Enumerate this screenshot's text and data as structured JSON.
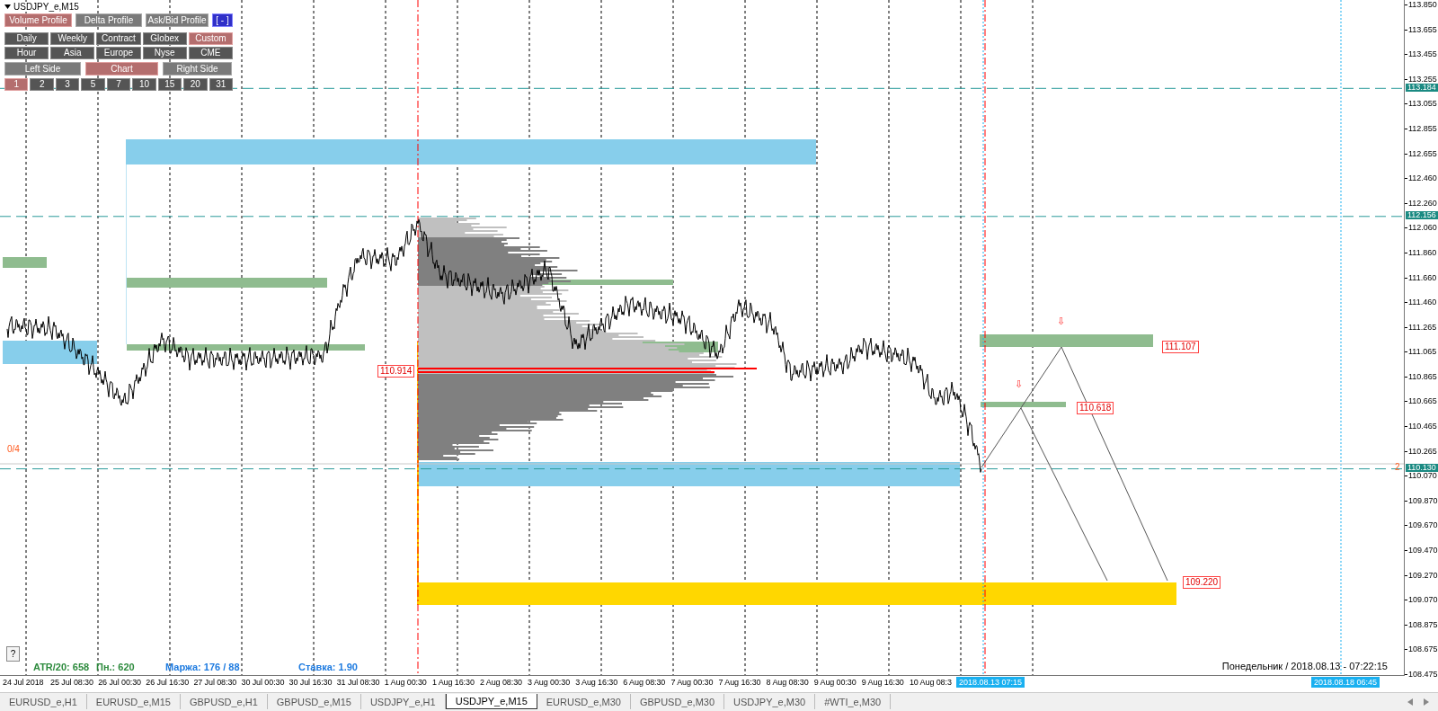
{
  "chart_window": {
    "title": "USDJPY_e,M15"
  },
  "indicator_panel": {
    "profile_tabs": [
      {
        "label": "Volume Profile",
        "selected": true
      },
      {
        "label": "Delta Profile",
        "selected": false
      },
      {
        "label": "Ask/Bid Profile",
        "selected": false
      }
    ],
    "collapse_button": "[ - ]",
    "range_buttons": [
      {
        "label": "Daily",
        "selected": false
      },
      {
        "label": "Weekly",
        "selected": false
      },
      {
        "label": "Contract",
        "selected": false
      },
      {
        "label": "Globex",
        "selected": false
      },
      {
        "label": "Custom",
        "selected": true
      },
      {
        "label": "Hour",
        "selected": false
      },
      {
        "label": "Asia",
        "selected": false
      },
      {
        "label": "Europe",
        "selected": false
      },
      {
        "label": "Nyse",
        "selected": false
      },
      {
        "label": "CME",
        "selected": false
      }
    ],
    "side_buttons": [
      {
        "label": "Left Side",
        "selected": false
      },
      {
        "label": "Chart",
        "selected": true
      },
      {
        "label": "Right Side",
        "selected": false
      }
    ],
    "count_buttons": [
      {
        "label": "1",
        "selected": true
      },
      {
        "label": "2",
        "selected": false
      },
      {
        "label": "3",
        "selected": false
      },
      {
        "label": "5",
        "selected": false
      },
      {
        "label": "7",
        "selected": false
      },
      {
        "label": "10",
        "selected": false
      },
      {
        "label": "15",
        "selected": false
      },
      {
        "label": "20",
        "selected": false
      },
      {
        "label": "31",
        "selected": false
      }
    ]
  },
  "chart": {
    "range_label": "0/4",
    "count_label": "2",
    "help_button": "?",
    "level_labels": [
      {
        "label": "110.914"
      },
      {
        "label": "111.107"
      },
      {
        "label": "110.618"
      },
      {
        "label": "109.220"
      }
    ],
    "sell_arrows": [
      "⇩",
      "⇩"
    ],
    "stats": [
      {
        "text": "ATR/20: 658",
        "color": "#2e8b3e"
      },
      {
        "text": "Пн.: 620",
        "color": "#2e8b3e"
      },
      {
        "text": "Маржа: 176 / 88",
        "color": "#1e7be0"
      },
      {
        "text": "Ставка: 1.90",
        "color": "#1e7be0"
      }
    ],
    "clock": "Понедельник / 2018.08.13 - 07:22:15"
  },
  "price_axis": {
    "labels": [
      "113.850",
      "113.655",
      "113.455",
      "113.255",
      "113.055",
      "112.855",
      "112.655",
      "112.460",
      "112.260",
      "112.060",
      "111.860",
      "111.660",
      "111.460",
      "111.265",
      "111.065",
      "110.865",
      "110.665",
      "110.465",
      "110.265",
      "110.070",
      "109.870",
      "109.670",
      "109.470",
      "109.270",
      "109.070",
      "108.875",
      "108.675",
      "108.475"
    ],
    "marked_prices": [
      "113.184",
      "112.156",
      "110.130"
    ]
  },
  "time_axis": {
    "labels": [
      "24 Jul 2018",
      "25 Jul 08:30",
      "26 Jul 00:30",
      "26 Jul 16:30",
      "27 Jul 08:30",
      "30 Jul 00:30",
      "30 Jul 16:30",
      "31 Jul 08:30",
      "1 Aug 00:30",
      "1 Aug 16:30",
      "2 Aug 08:30",
      "3 Aug 00:30",
      "3 Aug 16:30",
      "6 Aug 08:30",
      "7 Aug 00:30",
      "7 Aug 16:30",
      "8 Aug 08:30",
      "9 Aug 00:30",
      "9 Aug 16:30",
      "10 Aug 08:3"
    ],
    "marked_times": [
      "2018.08.13 07:15",
      "2018.08.18 06:45"
    ]
  },
  "symbol_tabs": [
    {
      "label": "EURUSD_e,H1",
      "selected": false
    },
    {
      "label": "EURUSD_e,M15",
      "selected": false
    },
    {
      "label": "GBPUSD_e,H1",
      "selected": false
    },
    {
      "label": "GBPUSD_e,M15",
      "selected": false
    },
    {
      "label": "USDJPY_e,H1",
      "selected": false
    },
    {
      "label": "USDJPY_e,M15",
      "selected": true
    },
    {
      "label": "EURUSD_e,M30",
      "selected": false
    },
    {
      "label": "GBPUSD_e,M30",
      "selected": false
    },
    {
      "label": "USDJPY_e,M30",
      "selected": false
    },
    {
      "label": "#WTI_e,M30",
      "selected": false
    }
  ]
}
